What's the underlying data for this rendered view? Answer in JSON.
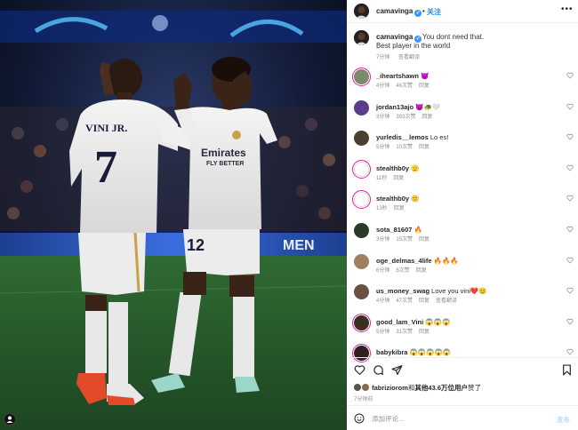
{
  "post": {
    "username": "camavinga",
    "follow_label": "关注",
    "separator": "•",
    "more_label": "•••",
    "caption_line1": "You dont need that.",
    "caption_line2": "Best player in the world",
    "caption_time": "7分钟",
    "caption_translate": "查看翻译",
    "jersey_left_name": "VINI JR.",
    "jersey_left_number": "7",
    "jersey_right_sponsor": "Emirates",
    "jersey_right_sponsor2": "FLY BETTER",
    "jersey_right_number": "12",
    "board_text": "MEN"
  },
  "comments": [
    {
      "user": "_iheartshawn",
      "text": "😈",
      "time": "4分钟",
      "likes": "46次赞",
      "reply": "回复",
      "avatar_color": "#7a8a6a",
      "ring": true
    },
    {
      "user": "jordan13ajo",
      "text": "😈🐢🤍",
      "time": "3分钟",
      "likes": "393次赞",
      "reply": "回复",
      "avatar_color": "#5a3d8a",
      "ring": false
    },
    {
      "user": "yurledis__lemos",
      "text": "Lo es!",
      "time": "5分钟",
      "likes": "10次赞",
      "reply": "回复",
      "avatar_color": "#4a4030",
      "ring": false
    },
    {
      "user": "stealthb0y",
      "text": "🫡",
      "time": "11秒",
      "likes": "",
      "reply": "回复",
      "avatar_color": "#ffffff",
      "ring": true
    },
    {
      "user": "stealthb0y",
      "text": "🙂",
      "time": "13秒",
      "likes": "",
      "reply": "回复",
      "avatar_color": "#ffffff",
      "ring": true
    },
    {
      "user": "sota_81607",
      "text": "🔥",
      "time": "3分钟",
      "likes": "15次赞",
      "reply": "回复",
      "avatar_color": "#2a3a2a",
      "ring": false
    },
    {
      "user": "oge_delmas_4life",
      "text": "🔥🔥🔥",
      "time": "6分钟",
      "likes": "6次赞",
      "reply": "回复",
      "avatar_color": "#a08060",
      "ring": false
    },
    {
      "user": "us_money_swag",
      "text": "Love you vini❤️😊",
      "time": "4分钟",
      "likes": "47次赞",
      "reply": "回复",
      "translate": "查看翻译",
      "avatar_color": "#6a5040",
      "ring": false
    },
    {
      "user": "good_lam_Vini",
      "text": "😱😱😱",
      "time": "5分钟",
      "likes": "31次赞",
      "reply": "回复",
      "avatar_color": "#3a3020",
      "ring": true
    },
    {
      "user": "babykibra",
      "text": "😱😱😱😱😱",
      "time": "",
      "likes": "",
      "reply": "",
      "avatar_color": "#302020",
      "ring": true
    }
  ],
  "likes": {
    "user": "fabriziorom",
    "text_mid": "和",
    "others": "其他43.6万位用户",
    "text_end": "赞了"
  },
  "posted_time": "7分钟前",
  "add_comment": {
    "placeholder": "添加评论...",
    "post_label": "发布"
  },
  "icons": {
    "like": "heart-icon",
    "comment": "comment-icon",
    "share": "share-icon",
    "save": "bookmark-icon",
    "emoji": "emoji-icon",
    "tag": "user-tag-icon"
  },
  "colors": {
    "accent": "#0095f6",
    "verified": "#3897f0",
    "secondary_text": "#8e8e8e"
  }
}
